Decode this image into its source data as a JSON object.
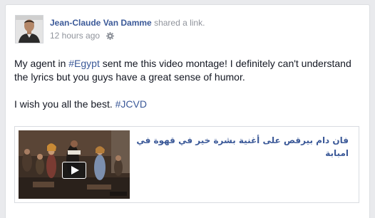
{
  "post": {
    "author_name": "Jean-Claude Van Damme",
    "action_text": " shared a link.",
    "timestamp": "12 hours ago",
    "privacy_icon": "gear-icon",
    "text_before_tag": "My agent in ",
    "tag_1": "#Egypt",
    "text_after_tag": " sent me this video montage! I definitely can't understand the lyrics but you guys have a great sense of humor.",
    "text_line_2": "I wish you all the best. ",
    "tag_2": "#JCVD"
  },
  "link_preview": {
    "title": "فان دام بيرقص على أغنية بشرة خير في قهوة في امبابة",
    "play_icon": "play-icon"
  },
  "colors": {
    "link_blue": "#3b5998",
    "meta_gray": "#90949c",
    "text": "#141823",
    "background": "#e9eaed"
  }
}
